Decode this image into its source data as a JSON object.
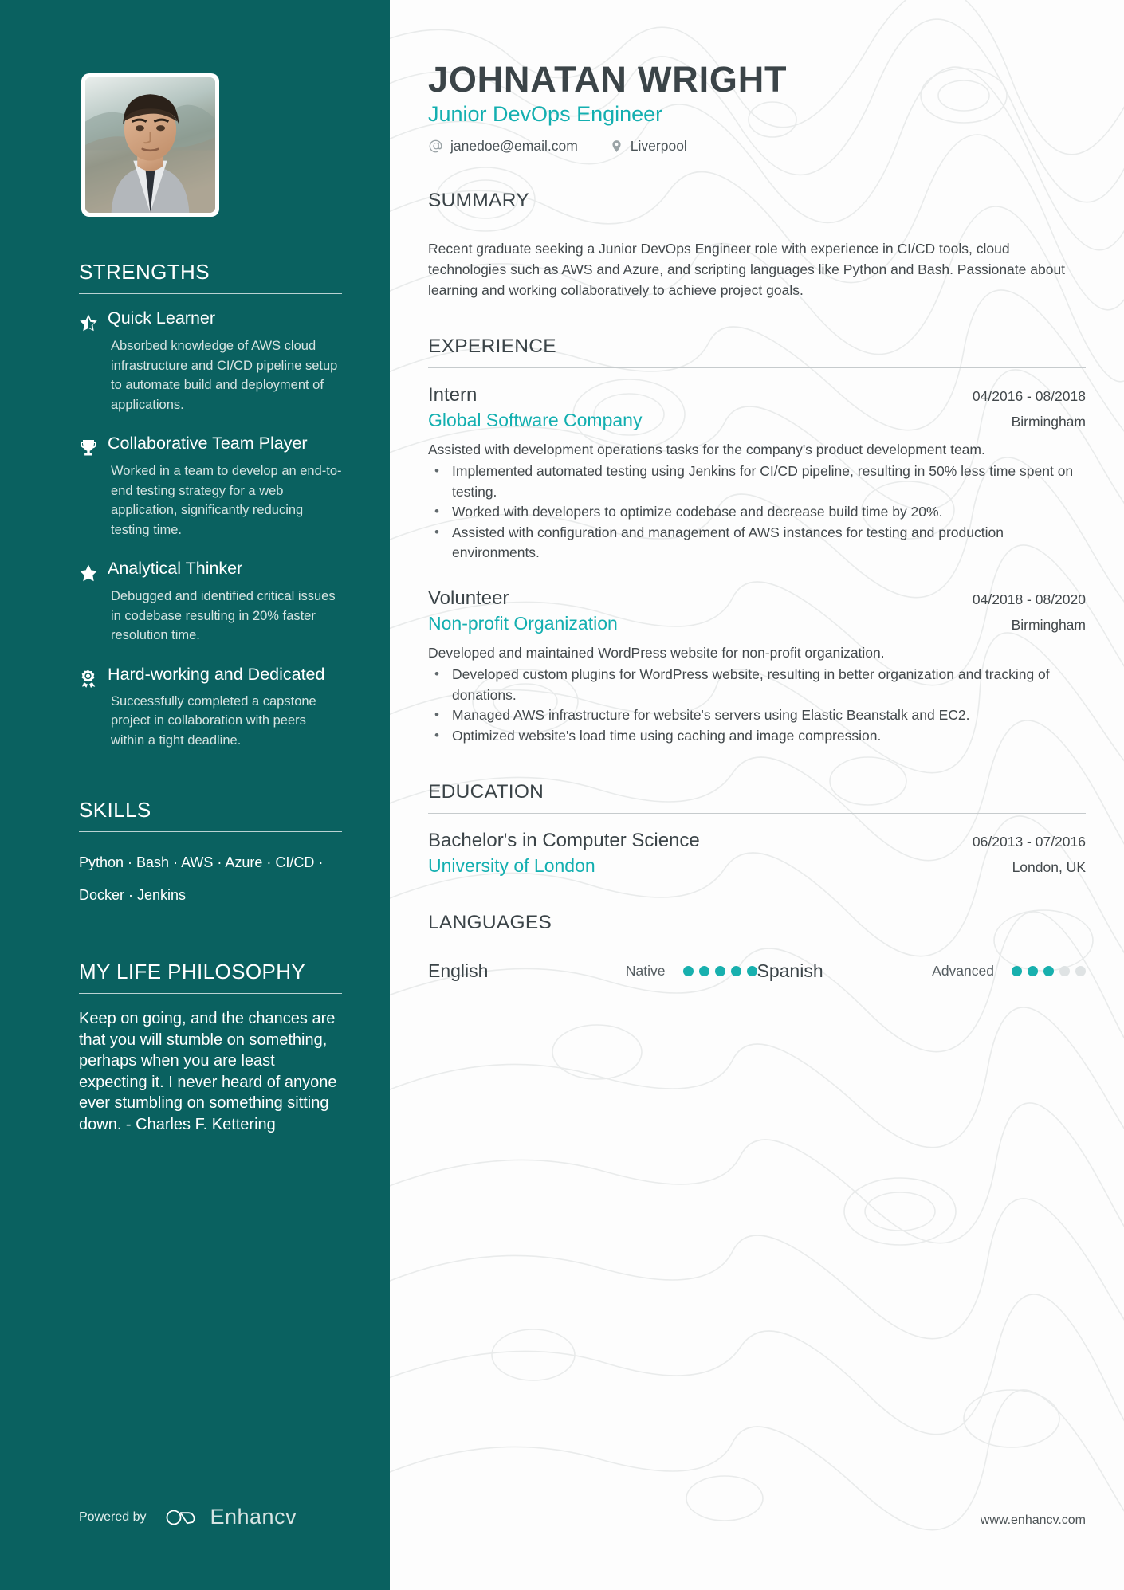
{
  "theme": {
    "sidebar_bg": "#0a6160",
    "accent": "#13afb0",
    "heading": "#3b4448",
    "body_text": "#43494c"
  },
  "header": {
    "name": "JOHNATAN WRIGHT",
    "role": "Junior DevOps Engineer",
    "contacts": [
      {
        "icon": "email-icon",
        "text": "janedoe@email.com"
      },
      {
        "icon": "location-pin-icon",
        "text": "Liverpool"
      }
    ]
  },
  "sidebar": {
    "avatar_alt": "profile-photo",
    "strengths": {
      "title": "STRENGTHS",
      "items": [
        {
          "icon": "half-star-icon",
          "name": "Quick Learner",
          "desc": "Absorbed knowledge of AWS cloud infrastructure and CI/CD pipeline setup to automate build and deployment of applications."
        },
        {
          "icon": "trophy-icon",
          "name": "Collaborative Team Player",
          "desc": "Worked in a team to develop an end-to-end testing strategy for a web application, significantly reducing testing time."
        },
        {
          "icon": "star-icon",
          "name": "Analytical Thinker",
          "desc": "Debugged and identified critical issues in codebase resulting in 20% faster resolution time."
        },
        {
          "icon": "award-ribbon-icon",
          "name": "Hard-working and Dedicated",
          "desc": "Successfully completed a capstone project in collaboration with peers within a tight deadline."
        }
      ]
    },
    "skills": {
      "title": "SKILLS",
      "items": [
        "Python",
        "Bash",
        "AWS",
        "Azure",
        "CI/CD",
        "Docker",
        "Jenkins"
      ],
      "separator": " · ",
      "text": "Python · Bash · AWS · Azure · CI/CD · Docker · Jenkins"
    },
    "philosophy": {
      "title": "MY LIFE PHILOSOPHY",
      "text": "Keep on going, and the chances are that you will stumble on something, perhaps when you are least expecting it. I never heard of anyone ever stumbling on something sitting down. - Charles F. Kettering"
    },
    "footer": {
      "powered_by": "Powered by",
      "brand": "Enhancv",
      "brand_icon": "enhancv-logo-icon"
    }
  },
  "main": {
    "summary": {
      "title": "SUMMARY",
      "text": "Recent graduate seeking a Junior DevOps Engineer role with experience in CI/CD tools, cloud technologies such as AWS and Azure, and scripting languages like Python and Bash. Passionate about learning and working collaboratively to achieve project goals."
    },
    "experience": {
      "title": "EXPERIENCE",
      "entries": [
        {
          "role": "Intern",
          "date": "04/2016 - 08/2018",
          "organization": "Global Software Company",
          "location": "Birmingham",
          "description": "Assisted with development operations tasks for the company's product development team.",
          "bullets": [
            "Implemented automated testing using Jenkins for CI/CD pipeline, resulting in 50% less time spent on testing.",
            "Worked with developers to optimize codebase and decrease build time by 20%.",
            "Assisted with configuration and management of AWS instances for testing and production environments."
          ]
        },
        {
          "role": "Volunteer",
          "date": "04/2018 - 08/2020",
          "organization": "Non-profit Organization",
          "location": "Birmingham",
          "description": "Developed and maintained WordPress website for non-profit organization.",
          "bullets": [
            "Developed custom plugins for WordPress website, resulting in better organization and tracking of donations.",
            "Managed AWS infrastructure for website's servers using Elastic Beanstalk and EC2.",
            "Optimized website's load time using caching and image compression."
          ]
        }
      ]
    },
    "education": {
      "title": "EDUCATION",
      "entries": [
        {
          "degree": "Bachelor's in Computer Science",
          "date": "06/2013 - 07/2016",
          "institution": "University of London",
          "location": "London, UK"
        }
      ]
    },
    "languages": {
      "title": "LANGUAGES",
      "items": [
        {
          "name": "English",
          "level": "Native",
          "dots_filled": 5,
          "dots_total": 5
        },
        {
          "name": "Spanish",
          "level": "Advanced",
          "dots_filled": 3,
          "dots_total": 5
        }
      ]
    },
    "footer": {
      "website": "www.enhancv.com"
    }
  }
}
